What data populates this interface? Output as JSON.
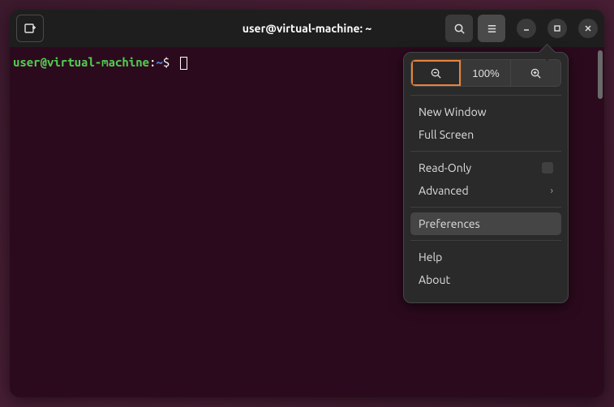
{
  "window": {
    "title": "user@virtual-machine: ~"
  },
  "terminal": {
    "prompt_user": "user@virtual-machine",
    "prompt_colon": ":",
    "prompt_path": "~",
    "prompt_dollar": "$"
  },
  "menu": {
    "zoom_level": "100%",
    "items": {
      "new_window": "New Window",
      "full_screen": "Full Screen",
      "read_only": "Read-Only",
      "advanced": "Advanced",
      "preferences": "Preferences",
      "help": "Help",
      "about": "About"
    }
  }
}
